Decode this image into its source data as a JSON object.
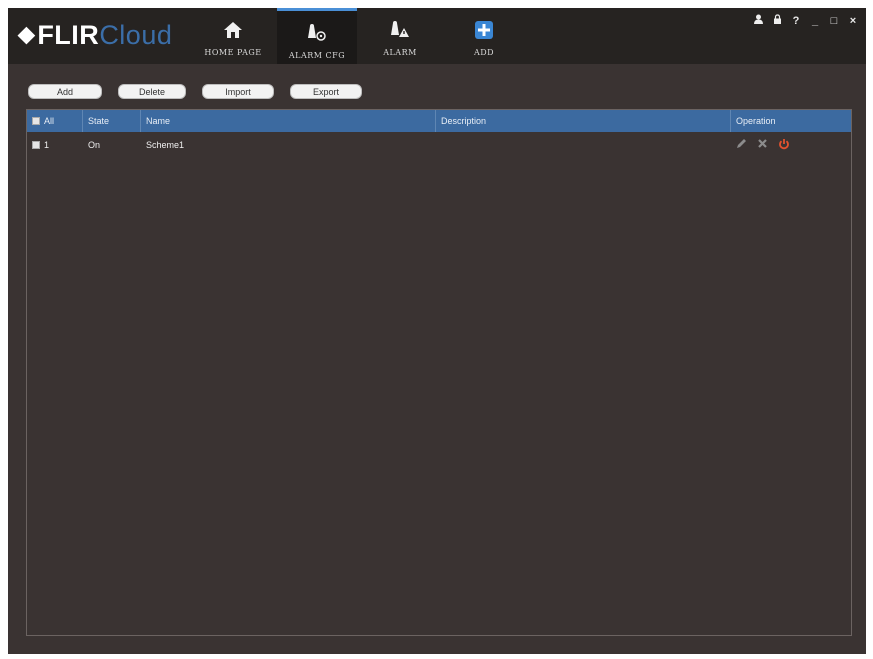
{
  "app": {
    "logo_mark": "⬥",
    "logo_flir": "FLIR",
    "logo_cloud": "Cloud",
    "nav_tabs": [
      {
        "label": "HOME PAGE",
        "icon": "home-icon"
      },
      {
        "label": "ALARM CFG",
        "icon": "alarm-config-icon"
      },
      {
        "label": "ALARM",
        "icon": "alarm-icon"
      },
      {
        "label": "ADD",
        "icon": "add-icon"
      }
    ],
    "active_tab": "ALARM CFG",
    "window_controls": {
      "user": "user-icon",
      "lock": "lock-icon",
      "help": "?",
      "minimize": "_",
      "maximize": "□",
      "close": "×"
    }
  },
  "toolbar": {
    "add": "Add",
    "delete": "Delete",
    "import": "Import",
    "export": "Export"
  },
  "table": {
    "columns": {
      "all": "All",
      "state": "State",
      "name": "Name",
      "description": "Description",
      "operation": "Operation"
    },
    "rows": [
      {
        "index": "1",
        "state": "On",
        "name": "Scheme1",
        "description": ""
      }
    ]
  },
  "colors": {
    "accent": "#3c6aa0",
    "power_icon": "#e2522f"
  }
}
